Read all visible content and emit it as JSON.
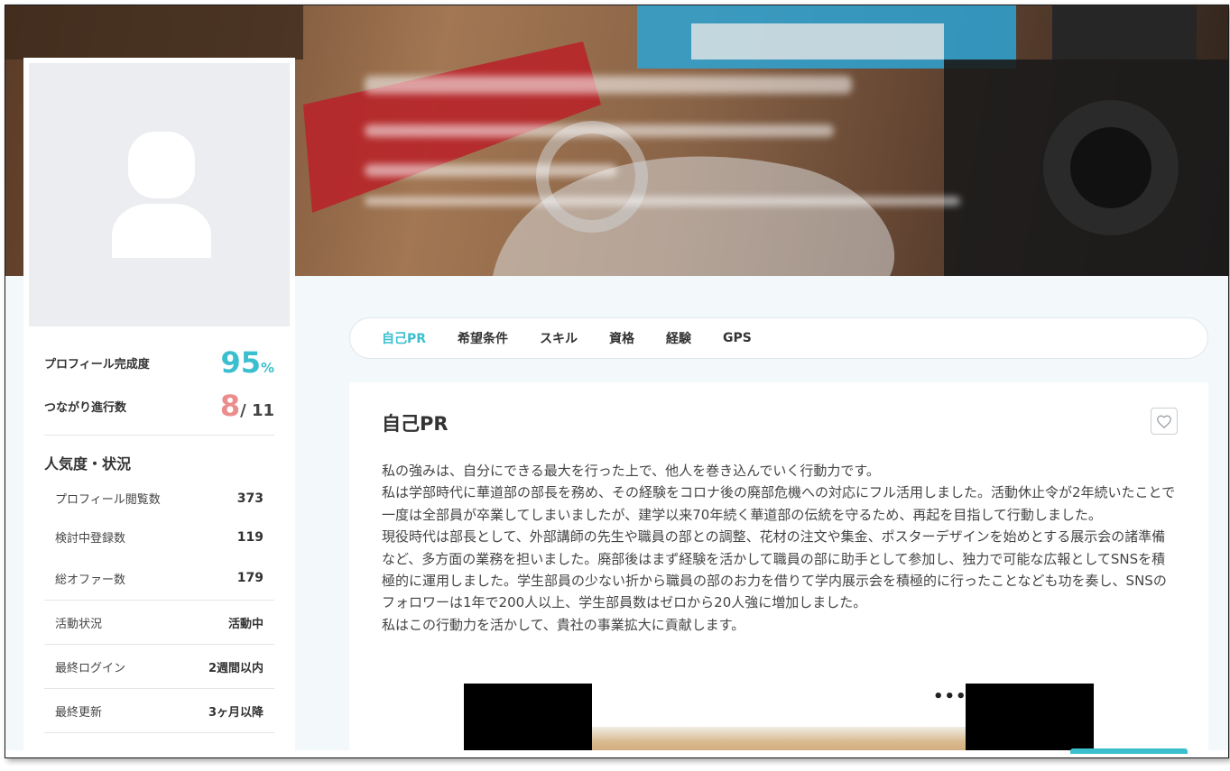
{
  "profile": {
    "completion_label": "プロフィール完成度",
    "completion_value": "95",
    "completion_unit": "%",
    "connections_label": "つながり進行数",
    "connections_value": "8",
    "connections_total": "/ 11"
  },
  "popularity": {
    "heading": "人気度・状況",
    "items": [
      {
        "label": "プロフィール閲覧数",
        "value": "373"
      },
      {
        "label": "検討中登録数",
        "value": "119"
      },
      {
        "label": "総オファー数",
        "value": "179"
      }
    ],
    "status": [
      {
        "label": "活動状況",
        "value": "活動中"
      },
      {
        "label": "最終ログイン",
        "value": "2週間以内"
      },
      {
        "label": "最終更新",
        "value": "3ヶ月以降"
      }
    ]
  },
  "tabs": [
    {
      "label": "自己PR",
      "active": true
    },
    {
      "label": "希望条件",
      "active": false
    },
    {
      "label": "スキル",
      "active": false
    },
    {
      "label": "資格",
      "active": false
    },
    {
      "label": "経験",
      "active": false
    },
    {
      "label": "GPS",
      "active": false
    }
  ],
  "pr": {
    "title": "自己PR",
    "paragraphs": [
      "私の強みは、自分にできる最大を行った上で、他人を巻き込んでいく行動力です。",
      "私は学部時代に華道部の部長を務め、その経験をコロナ後の廃部危機への対応にフル活用しました。活動休止令が2年続いたことで一度は全部員が卒業してしまいましたが、建学以来70年続く華道部の伝統を守るため、再起を目指して行動しました。",
      "現役時代は部長として、外部講師の先生や職員の部との調整、花材の注文や集金、ポスターデザインを始めとする展示会の諸準備など、多方面の業務を担いました。廃部後はまず経験を活かして職員の部に助手として参加し、独力で可能な広報としてSNSを積極的に運用しました。学生部員の少ない折から職員の部のお力を借りて学内展示会を積極的に行ったことなども功を奏し、SNSのフォロワーは1年で200人以上、学生部員数はゼロから20人強に増加しました。",
      "私はこの行動力を活かして、貴社の事業拡大に貢献します。"
    ],
    "video_menu": "•••"
  },
  "colors": {
    "accent": "#3bbfcf",
    "pink": "#ec8d8d"
  }
}
